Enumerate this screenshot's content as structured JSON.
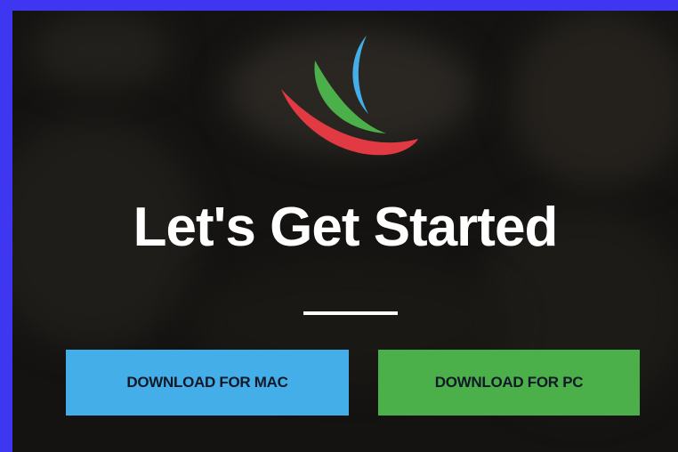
{
  "hero": {
    "title": "Let's Get Started"
  },
  "buttons": {
    "mac_label": "DOWNLOAD FOR MAC",
    "pc_label": "DOWNLOAD FOR PC"
  },
  "logo": {
    "icon": "sail-logo-icon",
    "colors": [
      "#e23a42",
      "#4bb04a",
      "#44aee8"
    ]
  },
  "colors": {
    "frame": "#3f36f2",
    "background": "#141311",
    "mac_button": "#44aee8",
    "pc_button": "#4bb04a"
  }
}
